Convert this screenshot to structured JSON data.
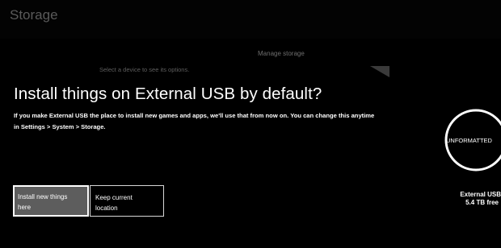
{
  "header": {
    "title": "Storage"
  },
  "background": {
    "manage_storage_label": "Manage storage",
    "select_device_hint": "Select a device to see its options."
  },
  "dialog": {
    "title": "Install things on External USB by default?",
    "body_line1": "If you make External USB the place to install new games and apps, we'll use that from now on. You can change this anytime",
    "body_line2": "in Settings > System > Storage.",
    "primary_button_line1": "Install new things",
    "primary_button_line2": "here",
    "secondary_button_line1": "Keep current",
    "secondary_button_line2": "location"
  },
  "device": {
    "status": "UNFORMATTED",
    "name": "External USB",
    "free_space": "5.4 TB free"
  },
  "colors": {
    "background": "#000000",
    "primary_button_fill": "#5d5d5d",
    "text": "#ffffff",
    "dim_text": "#5a5a5a"
  }
}
